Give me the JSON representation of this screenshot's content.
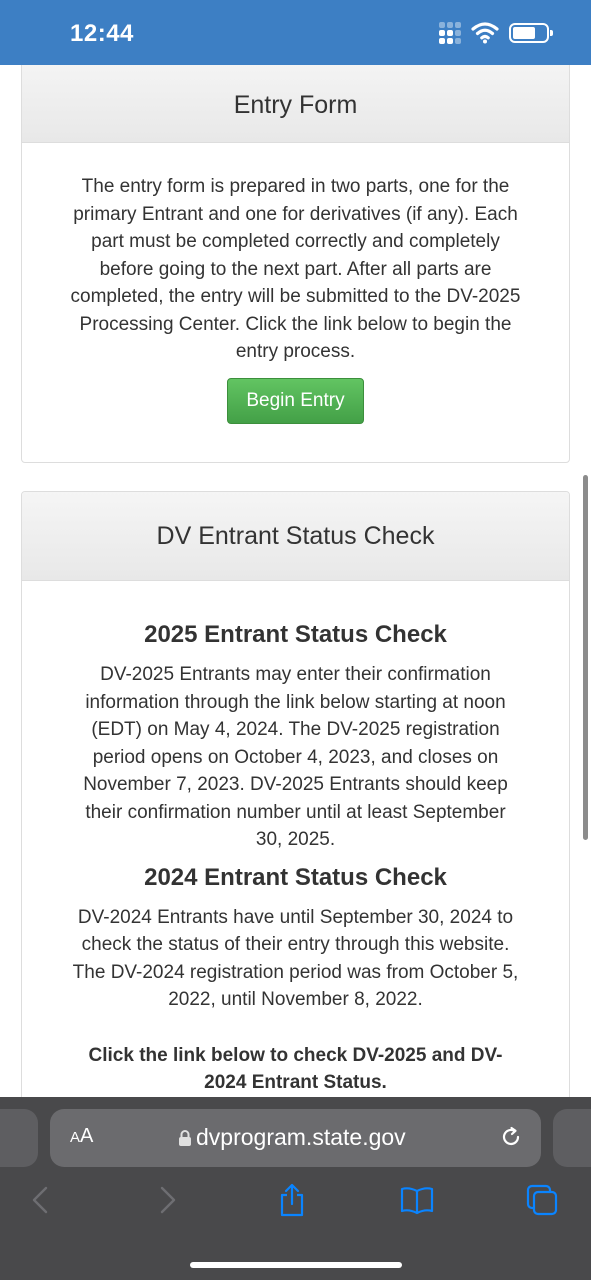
{
  "status_bar": {
    "time": "12:44",
    "icons": [
      "cellular-signal-icon",
      "wifi-icon",
      "battery-icon"
    ],
    "background": "#3d7fc4"
  },
  "entry_form": {
    "heading": "Entry Form",
    "description": "The entry form is prepared in two parts, one for the primary Entrant and one for derivatives (if any). Each part must be completed correctly and completely before going to the next part. After all parts are completed, the entry will be submitted to the DV-2025 Processing Center. Click the link below to begin the entry process.",
    "button_label": "Begin Entry",
    "button_color": "#4cae4c"
  },
  "status_check": {
    "heading": "DV Entrant Status Check",
    "sections": [
      {
        "title": "2025 Entrant Status Check",
        "text": "DV-2025 Entrants may enter their confirmation information through the link below starting at noon (EDT) on May 4, 2024. The DV-2025 registration period opens on October 4, 2023, and closes on November 7, 2023. DV-2025 Entrants should keep their confirmation number until at least September 30, 2025."
      },
      {
        "title": "2024 Entrant Status Check",
        "text": "DV-2024 Entrants have until September 30, 2024 to check the status of their entry through this website. The DV-2024 registration period was from October 5, 2022, until November 8, 2022."
      }
    ],
    "note": "Click the link below to check DV-2025 and DV-2024 Entrant Status."
  },
  "browser": {
    "aa_label_big": "A",
    "aa_label_small": "A",
    "url": "dvprogram.state.gov",
    "toolbar_icons": [
      "back-icon",
      "forward-icon",
      "share-icon",
      "bookmarks-icon",
      "tabs-icon"
    ],
    "accent": "#0a84ff"
  }
}
